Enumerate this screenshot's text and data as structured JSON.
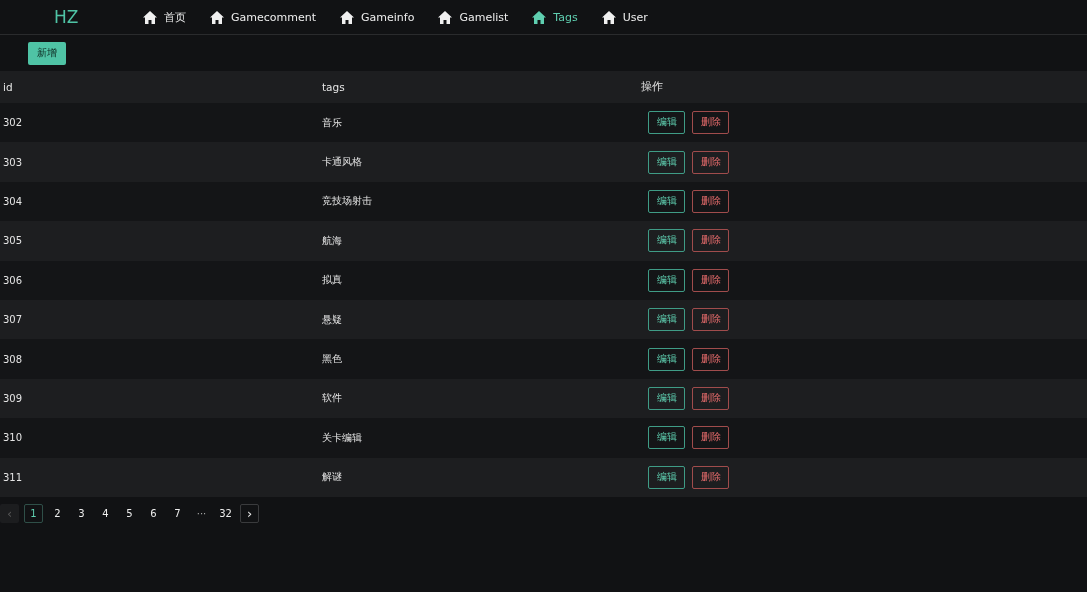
{
  "header": {
    "logo": "HZ",
    "nav": [
      {
        "label": "首页",
        "selected": false
      },
      {
        "label": "Gamecomment",
        "selected": false
      },
      {
        "label": "Gameinfo",
        "selected": false
      },
      {
        "label": "Gamelist",
        "selected": false
      },
      {
        "label": "Tags",
        "selected": true
      },
      {
        "label": "User",
        "selected": false
      }
    ]
  },
  "toolbar": {
    "add_button": "新增"
  },
  "table": {
    "columns": [
      "id",
      "tags",
      "操作"
    ],
    "rows": [
      {
        "id": "302",
        "tags": "音乐",
        "edit": "编辑",
        "delete": "删除"
      },
      {
        "id": "303",
        "tags": "卡通风格",
        "edit": "编辑",
        "delete": "删除"
      },
      {
        "id": "304",
        "tags": "竞技场射击",
        "edit": "编辑",
        "delete": "删除"
      },
      {
        "id": "305",
        "tags": "航海",
        "edit": "编辑",
        "delete": "删除"
      },
      {
        "id": "306",
        "tags": "拟真",
        "edit": "编辑",
        "delete": "删除"
      },
      {
        "id": "307",
        "tags": "悬疑",
        "edit": "编辑",
        "delete": "删除"
      },
      {
        "id": "308",
        "tags": "黑色",
        "edit": "编辑",
        "delete": "删除"
      },
      {
        "id": "309",
        "tags": "软件",
        "edit": "编辑",
        "delete": "删除"
      },
      {
        "id": "310",
        "tags": "关卡编辑",
        "edit": "编辑",
        "delete": "删除"
      },
      {
        "id": "311",
        "tags": "解谜",
        "edit": "编辑",
        "delete": "删除"
      }
    ]
  },
  "pagination": {
    "prev": {
      "label": "‹",
      "disabled": true
    },
    "items": [
      {
        "kind": "page",
        "label": "1",
        "selected": true
      },
      {
        "kind": "page",
        "label": "2",
        "selected": false
      },
      {
        "kind": "page",
        "label": "3",
        "selected": false
      },
      {
        "kind": "page",
        "label": "4",
        "selected": false
      },
      {
        "kind": "page",
        "label": "5",
        "selected": false
      },
      {
        "kind": "page",
        "label": "6",
        "selected": false
      },
      {
        "kind": "page",
        "label": "7",
        "selected": false
      },
      {
        "kind": "ellipsis",
        "label": "···"
      },
      {
        "kind": "page",
        "label": "32",
        "selected": false
      }
    ],
    "next": {
      "label": "›",
      "disabled": false
    }
  }
}
